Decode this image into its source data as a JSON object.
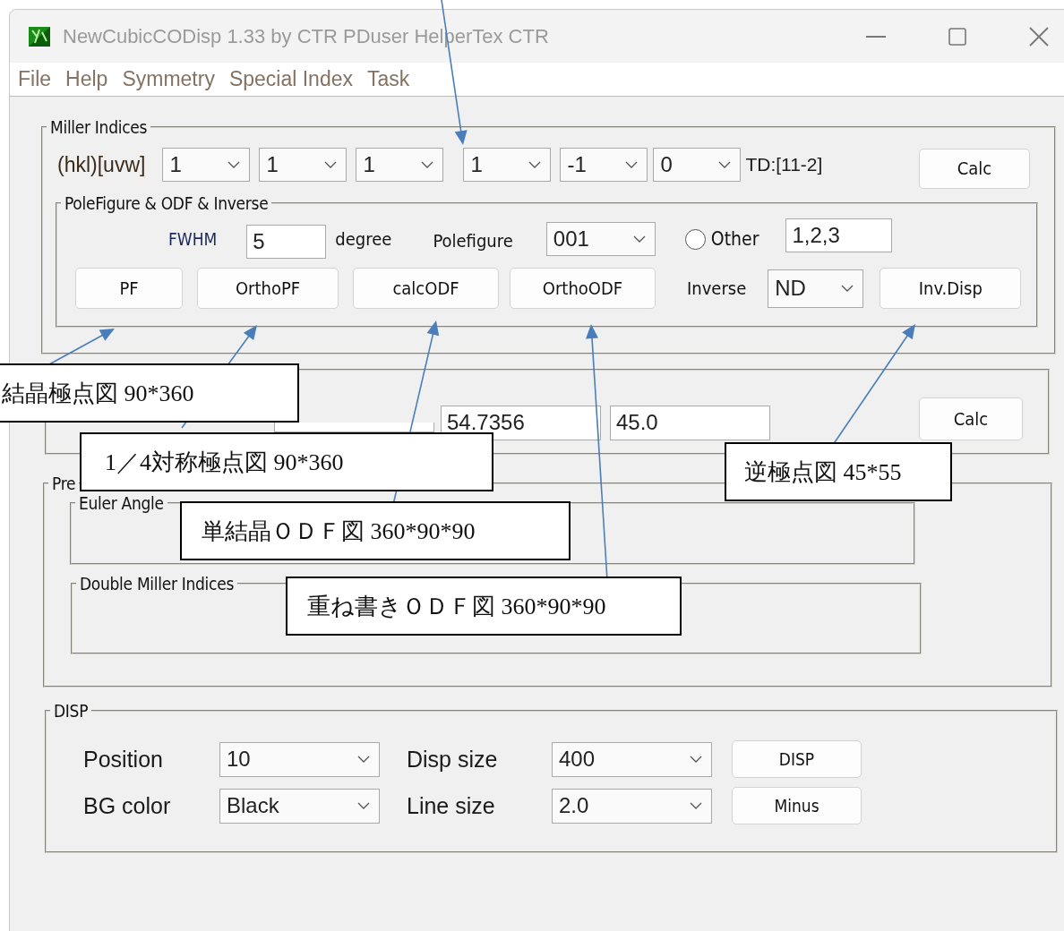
{
  "window": {
    "title": "NewCubicCODisp 1.33 by CTR PDuser HelperTex CTR"
  },
  "menu": [
    "File",
    "Help",
    "Symmetry",
    "Special Index",
    "Task"
  ],
  "miller_indices": {
    "label": "Miller Indices",
    "row_label": "(hkl)[uvw]",
    "hkl": [
      "1",
      "1",
      "1"
    ],
    "uvw": [
      "1",
      "-1",
      "0"
    ],
    "td": "TD:[11-2]",
    "calc_button": "Calc",
    "pole_group": {
      "label": "PoleFigure & ODF & Inverse",
      "fwhm_label": "FWHM",
      "fwhm_value": "5",
      "unit": "degree",
      "polefigure_label": "Polefigure",
      "polefigure_value": "001",
      "other_radio": {
        "label": "Other",
        "selected": false
      },
      "other_value": "1,2,3",
      "buttons": [
        "PF",
        "OrthoPF",
        "calcODF",
        "OrthoODF"
      ],
      "inverse_label": "Inverse",
      "inverse_value": "ND",
      "inverse_button": "Inv.Disp"
    }
  },
  "euler_row": {
    "values": [
      "54.7356",
      "45.0"
    ],
    "calc_button": "Calc"
  },
  "preset_group": {
    "label": "Pre",
    "euler_label": "Euler Angle",
    "double_label": "Double Miller Indices"
  },
  "disp": {
    "label": "DISP",
    "fields": [
      {
        "label": "Position",
        "value": "10"
      },
      {
        "label": "Disp size",
        "value": "400"
      },
      {
        "label": "BG color",
        "value": "Black"
      },
      {
        "label": "Line size",
        "value": "2.0"
      }
    ],
    "buttons": [
      "DISP",
      "Minus"
    ]
  },
  "callouts": [
    {
      "text": "結晶極点図 90*360"
    },
    {
      "text": "1／4対称極点図 90*360"
    },
    {
      "text": "単結晶ＯＤＦ図 360*90*90"
    },
    {
      "text": "重ね書きＯＤＦ図 360*90*90"
    },
    {
      "text": "逆極点図 45*55"
    }
  ]
}
